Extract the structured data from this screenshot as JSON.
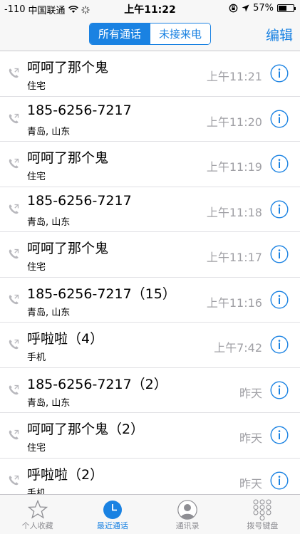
{
  "status_bar": {
    "signal": "-110",
    "carrier": "中国联通",
    "time": "上午11:22",
    "battery": "57%",
    "battery_level": 0.57
  },
  "nav": {
    "segments": [
      "所有通话",
      "未接来电"
    ],
    "active_segment": 0,
    "edit_label": "编辑"
  },
  "calls": [
    {
      "name": "呵呵了那个鬼",
      "sub": "住宅",
      "time": "上午11:21"
    },
    {
      "name": "185-6256-7217",
      "sub": "青岛, 山东",
      "time": "上午11:20"
    },
    {
      "name": "呵呵了那个鬼",
      "sub": "住宅",
      "time": "上午11:19"
    },
    {
      "name": "185-6256-7217",
      "sub": "青岛, 山东",
      "time": "上午11:18"
    },
    {
      "name": "呵呵了那个鬼",
      "sub": "住宅",
      "time": "上午11:17"
    },
    {
      "name": "185-6256-7217（15）",
      "sub": "青岛, 山东",
      "time": "上午11:16"
    },
    {
      "name": "呼啦啦（4）",
      "sub": "手机",
      "time": "上午7:42"
    },
    {
      "name": "185-6256-7217（2）",
      "sub": "青岛, 山东",
      "time": "昨天"
    },
    {
      "name": "呵呵了那个鬼（2）",
      "sub": "住宅",
      "time": "昨天"
    },
    {
      "name": "呼啦啦（2）",
      "sub": "手机",
      "time": "昨天"
    }
  ],
  "tabs": [
    {
      "label": "个人收藏",
      "icon": "star-icon"
    },
    {
      "label": "最近通话",
      "icon": "clock-icon",
      "active": true
    },
    {
      "label": "通讯录",
      "icon": "contacts-icon"
    },
    {
      "label": "拨号键盘",
      "icon": "keypad-icon"
    }
  ],
  "colors": {
    "accent": "#1a82e2",
    "secondary_text": "#a0a0a5",
    "bar_background": "#f7f7f7"
  }
}
